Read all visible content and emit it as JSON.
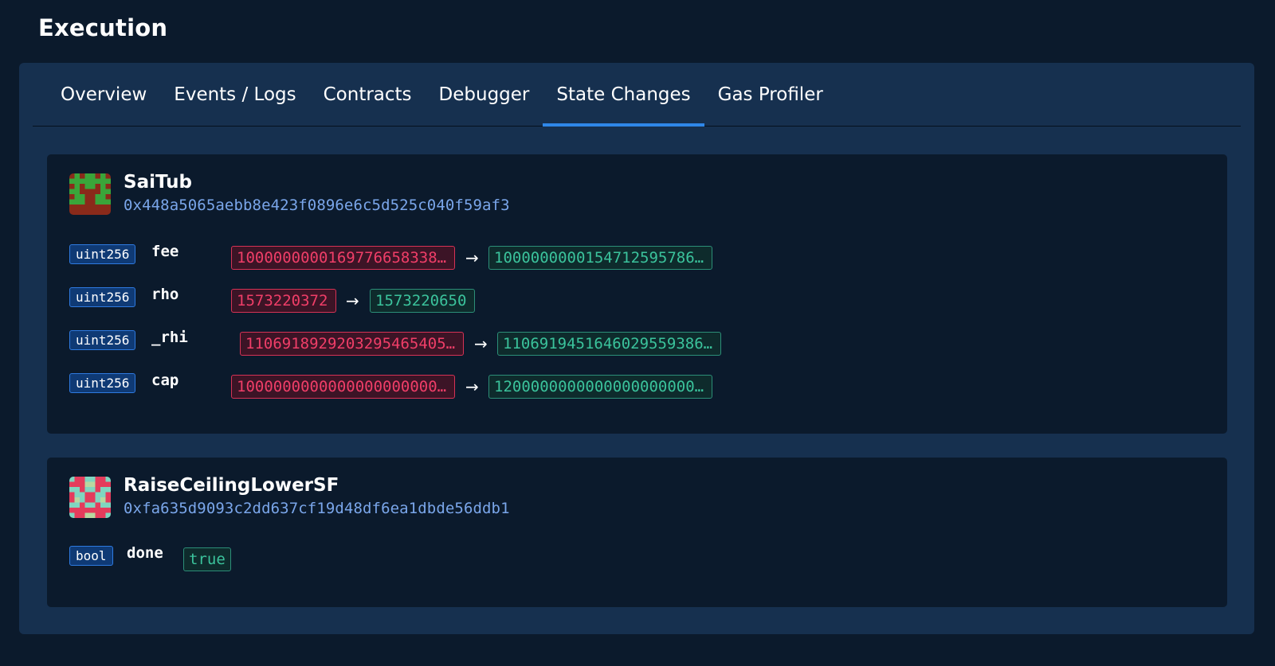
{
  "page": {
    "title": "Execution"
  },
  "tabs": [
    {
      "label": "Overview",
      "active": false
    },
    {
      "label": "Events / Logs",
      "active": false
    },
    {
      "label": "Contracts",
      "active": false
    },
    {
      "label": "Debugger",
      "active": false
    },
    {
      "label": "State Changes",
      "active": true
    },
    {
      "label": "Gas Profiler",
      "active": false
    }
  ],
  "contracts": [
    {
      "name": "SaiTub",
      "address": "0x448a5065aebb8e423f0896e6c5d525c040f59af3",
      "avatar_icon": "identicon-green-red",
      "changes": [
        {
          "type": "uint256",
          "name": "fee",
          "old": "1000000000169776658338…",
          "new": "1000000000154712595786…"
        },
        {
          "type": "uint256",
          "name": "rho",
          "old": "1573220372",
          "new": "1573220650"
        },
        {
          "type": "uint256",
          "name": "_rhi",
          "old": "1106918929203295465405…",
          "new": "1106919451646029559386…"
        },
        {
          "type": "uint256",
          "name": "cap",
          "old": "1000000000000000000000…",
          "new": "1200000000000000000000…"
        }
      ]
    },
    {
      "name": "RaiseCeilingLowerSF",
      "address": "0xfa635d9093c2dd637cf19d48df6ea1dbde56ddb1",
      "avatar_icon": "identicon-red-teal",
      "changes": [
        {
          "type": "bool",
          "name": "done",
          "value": "true"
        }
      ]
    }
  ],
  "arrow_glyph": "→",
  "colors": {
    "background": "#0b1a2c",
    "panel": "#16304f",
    "accent": "#2f87e8",
    "old_value": "#f03e68",
    "new_value": "#3bc39c",
    "address": "#7aa6ea"
  }
}
